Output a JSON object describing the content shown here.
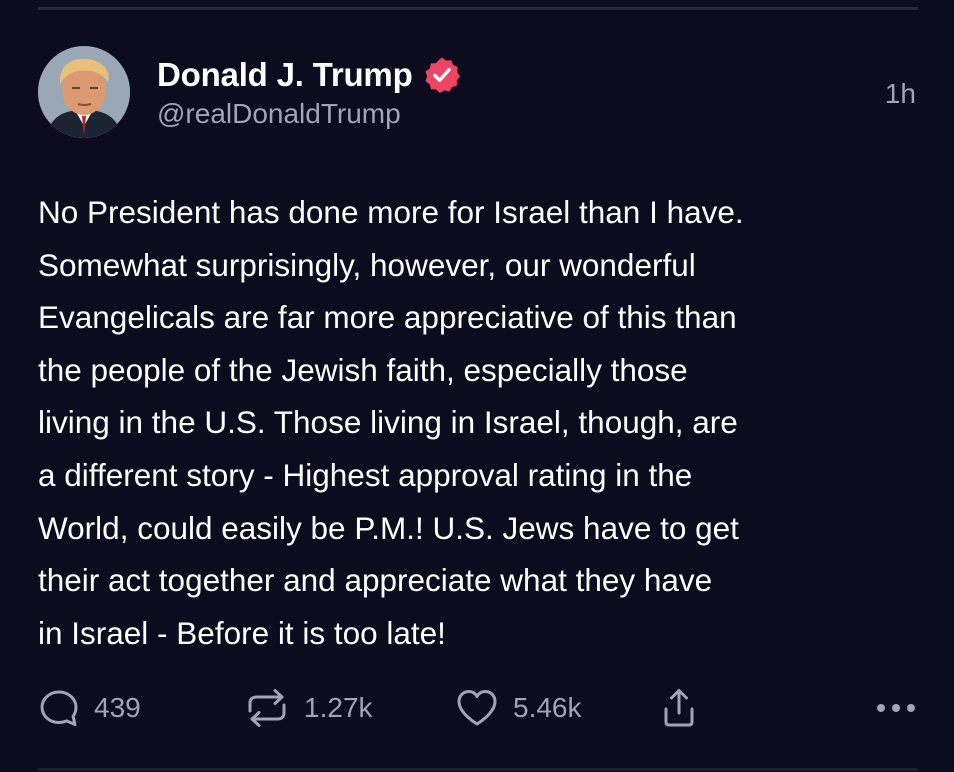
{
  "post": {
    "author": {
      "display_name": "Donald J. Trump",
      "handle": "@realDonaldTrump",
      "verified": true,
      "avatar_icon": "profile-photo"
    },
    "timestamp": "1h",
    "text": "No President has done more for Israel than I have.\nSomewhat surprisingly, however, our wonderful\nEvangelicals are far more appreciative of this than\nthe people of the Jewish faith, especially those\nliving in the U.S. Those living in Israel, though, are\na different story - Highest approval rating in the\nWorld, could easily be P.M.! U.S. Jews have to get\ntheir act together and appreciate what they have\nin Israel - Before it is too late!",
    "actions": {
      "reply_count": "439",
      "repost_count": "1.27k",
      "like_count": "5.46k"
    }
  },
  "icons": {
    "reply": "speech-bubble-icon",
    "repost": "repost-arrows-icon",
    "like": "heart-icon",
    "share": "share-arrow-icon",
    "more": "ellipsis-icon",
    "verified": "verified-badge-icon"
  },
  "colors": {
    "background": "#0d0b1e",
    "text_primary": "#ffffff",
    "text_secondary": "#a4a3b3",
    "verified_badge": "#ef4565"
  }
}
